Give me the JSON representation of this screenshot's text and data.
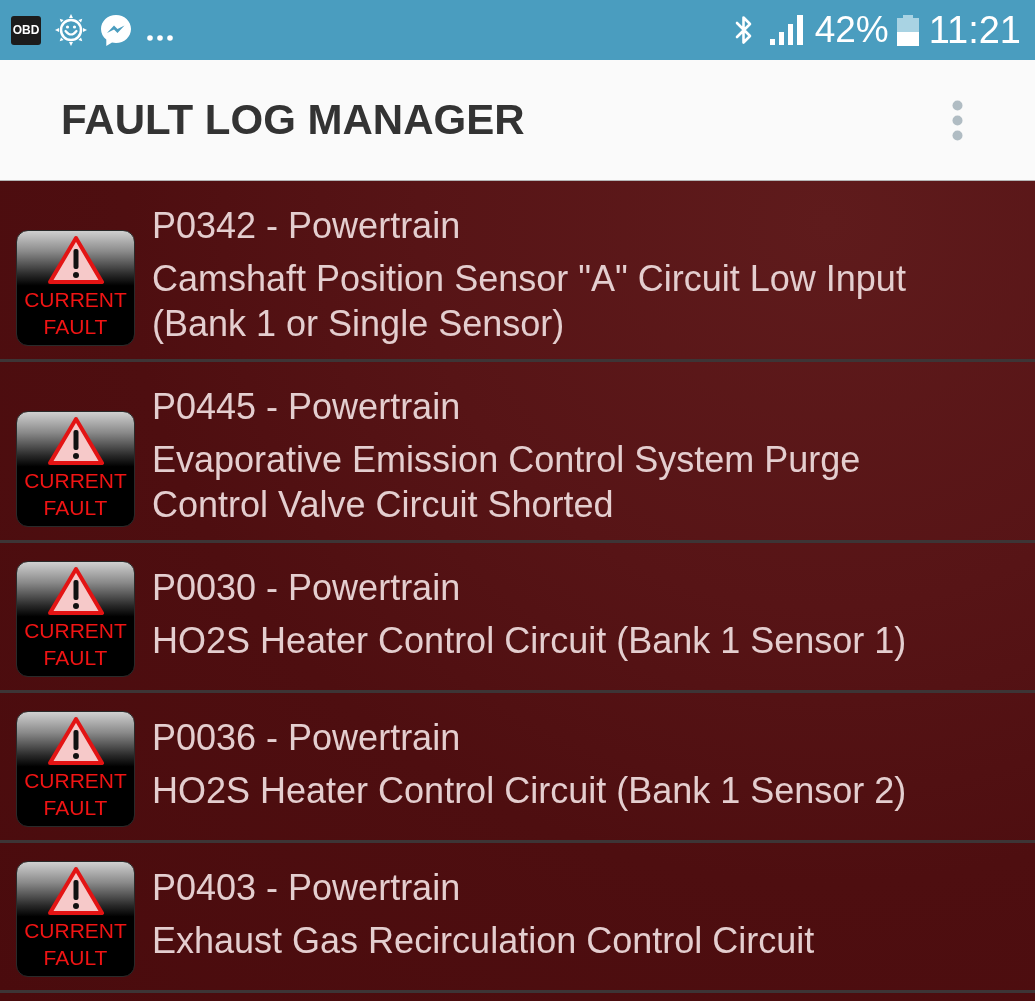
{
  "status_bar": {
    "notification_badge": "OBD",
    "battery_percent": "42%",
    "time": "11:21"
  },
  "app_bar": {
    "title": "FAULT LOG MANAGER"
  },
  "faults": [
    {
      "code_line": "P0342 - Powertrain",
      "description": "Camshaft Position Sensor \"A\" Circuit Low Input (Bank 1 or Single Sensor)",
      "badge": "CURRENT FAULT"
    },
    {
      "code_line": "P0445 - Powertrain",
      "description": "Evaporative Emission Control System Purge Control Valve Circuit Shorted",
      "badge": "CURRENT FAULT"
    },
    {
      "code_line": "P0030 - Powertrain",
      "description": "HO2S Heater Control Circuit (Bank 1 Sensor 1)",
      "badge": "CURRENT FAULT"
    },
    {
      "code_line": "P0036 - Powertrain",
      "description": "HO2S Heater Control Circuit (Bank 1 Sensor 2)",
      "badge": "CURRENT FAULT"
    },
    {
      "code_line": "P0403 - Powertrain",
      "description": "Exhaust Gas Recirculation Control Circuit",
      "badge": "CURRENT FAULT"
    }
  ]
}
